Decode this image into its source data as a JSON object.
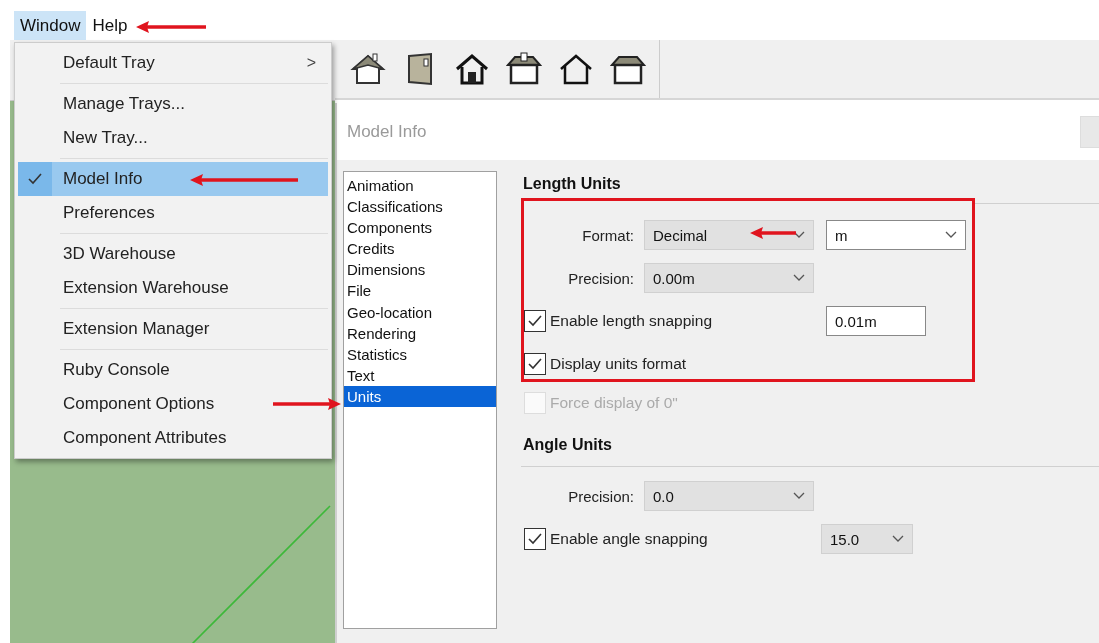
{
  "menubar": [
    {
      "label": "Window",
      "selected": true
    },
    {
      "label": "Help",
      "selected": false
    }
  ],
  "menu": {
    "groups": [
      [
        {
          "label": "Default Tray",
          "submenu": ">",
          "checked": false,
          "selected": false
        }
      ],
      [
        {
          "label": "Manage Trays...",
          "checked": false,
          "selected": false
        },
        {
          "label": "New Tray...",
          "checked": false,
          "selected": false
        }
      ],
      [
        {
          "label": "Model Info",
          "checked": true,
          "selected": true
        },
        {
          "label": "Preferences",
          "checked": false,
          "selected": false
        }
      ],
      [
        {
          "label": "3D Warehouse",
          "checked": false,
          "selected": false
        },
        {
          "label": "Extension Warehouse",
          "checked": false,
          "selected": false
        }
      ],
      [
        {
          "label": "Extension Manager",
          "checked": false,
          "selected": false
        }
      ],
      [
        {
          "label": "Ruby Console",
          "checked": false,
          "selected": false
        },
        {
          "label": "Component Options",
          "checked": false,
          "selected": false
        },
        {
          "label": "Component Attributes",
          "checked": false,
          "selected": false
        }
      ]
    ]
  },
  "panel": {
    "title": "Model Info",
    "categories": [
      {
        "label": "Animation",
        "selected": false
      },
      {
        "label": "Classifications",
        "selected": false
      },
      {
        "label": "Components",
        "selected": false
      },
      {
        "label": "Credits",
        "selected": false
      },
      {
        "label": "Dimensions",
        "selected": false
      },
      {
        "label": "File",
        "selected": false
      },
      {
        "label": "Geo-location",
        "selected": false
      },
      {
        "label": "Rendering",
        "selected": false
      },
      {
        "label": "Statistics",
        "selected": false
      },
      {
        "label": "Text",
        "selected": false
      },
      {
        "label": "Units",
        "selected": true
      }
    ],
    "sections": [
      {
        "title": "Length Units",
        "rows": [
          {
            "kind": "select",
            "label": "Format:",
            "value": "Decimal",
            "extra_select": "m",
            "highlighted": true
          },
          {
            "kind": "select",
            "label": "Precision:",
            "value": "0.00m",
            "highlighted": true
          },
          {
            "kind": "checkbox",
            "label": "Enable length snapping",
            "checked": true,
            "disabled": false,
            "field": "0.01m",
            "highlighted": true
          },
          {
            "kind": "checkbox",
            "label": "Display units format",
            "checked": true,
            "disabled": false,
            "highlighted": true
          },
          {
            "kind": "checkbox",
            "label": "Force display of 0\"",
            "checked": false,
            "disabled": true,
            "highlighted": false
          }
        ]
      },
      {
        "title": "Angle Units",
        "rows": [
          {
            "kind": "select",
            "label": "Precision:",
            "value": "0.0",
            "highlighted": false
          },
          {
            "kind": "checkbox",
            "label": "Enable angle snapping",
            "checked": true,
            "disabled": false,
            "extra_select": "15.0",
            "highlighted": false
          }
        ]
      }
    ]
  }
}
